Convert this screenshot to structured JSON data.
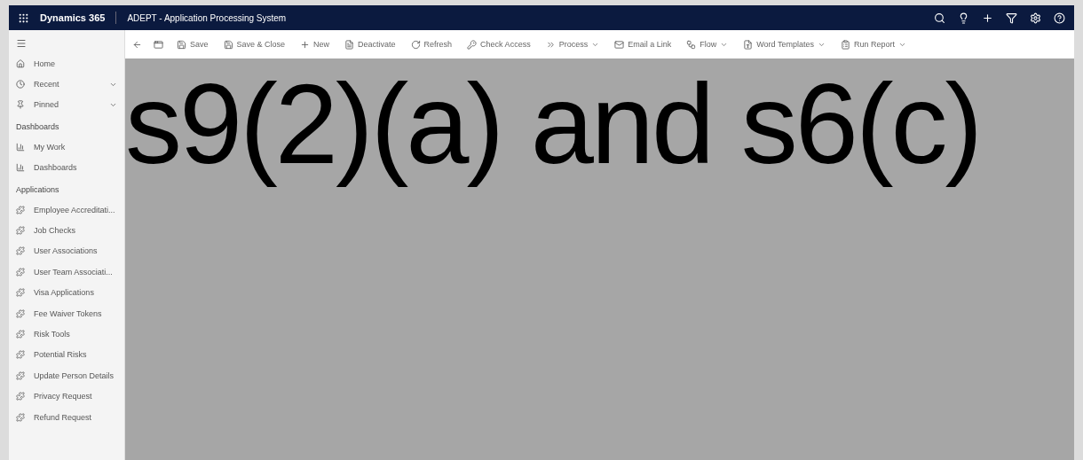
{
  "header": {
    "app_name": "Dynamics 365",
    "title": "ADEPT - Application Processing System"
  },
  "toolbar": [
    {
      "kind": "icon"
    },
    {
      "kind": "icon"
    },
    {
      "kind": "button",
      "label": "Save",
      "menu": false
    },
    {
      "kind": "button",
      "label": "Save & Close",
      "menu": false
    },
    {
      "kind": "button",
      "label": "New",
      "menu": false
    },
    {
      "kind": "button",
      "label": "Deactivate",
      "menu": false
    },
    {
      "kind": "button",
      "label": "Refresh",
      "menu": false
    },
    {
      "kind": "button",
      "label": "Check Access",
      "menu": false
    },
    {
      "kind": "button",
      "label": "Process",
      "menu": true
    },
    {
      "kind": "button",
      "label": "Email a Link",
      "menu": false
    },
    {
      "kind": "button",
      "label": "Flow",
      "menu": true
    },
    {
      "kind": "button",
      "label": "Word Templates",
      "menu": true
    },
    {
      "kind": "button",
      "label": "Run Report",
      "menu": true
    }
  ],
  "sidebar": {
    "top": [
      {
        "label": "Home",
        "expandable": false
      },
      {
        "label": "Recent",
        "expandable": true
      },
      {
        "label": "Pinned",
        "expandable": true
      }
    ],
    "groups": [
      {
        "title": "Dashboards",
        "items": [
          {
            "label": "My Work"
          },
          {
            "label": "Dashboards"
          }
        ]
      },
      {
        "title": "Applications",
        "items": [
          {
            "label": "Employee Accreditati..."
          },
          {
            "label": "Job Checks"
          },
          {
            "label": "User Associations"
          },
          {
            "label": "User Team Associati..."
          },
          {
            "label": "Visa Applications"
          },
          {
            "label": "Fee Waiver Tokens"
          },
          {
            "label": "Risk Tools"
          },
          {
            "label": "Potential Risks"
          },
          {
            "label": "Update Person Details"
          },
          {
            "label": "Privacy Request"
          },
          {
            "label": "Refund Request"
          }
        ]
      }
    ]
  },
  "redaction": {
    "text": "s9(2)(a) and s6(c)"
  }
}
